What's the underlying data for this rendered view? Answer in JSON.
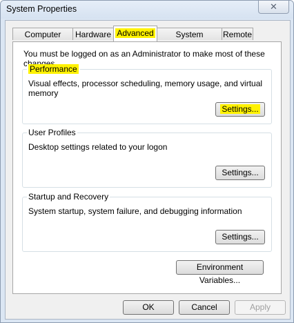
{
  "window": {
    "title": "System Properties",
    "close_glyph": "✕"
  },
  "tabs": [
    {
      "label": "Computer Name",
      "active": false
    },
    {
      "label": "Hardware",
      "active": false
    },
    {
      "label": "Advanced",
      "active": true
    },
    {
      "label": "System Protection",
      "active": false
    },
    {
      "label": "Remote",
      "active": false
    }
  ],
  "notice": "You must be logged on as an Administrator to make most of these changes.",
  "groups": {
    "performance": {
      "label": "Performance",
      "description": "Visual effects, processor scheduling, memory usage, and virtual memory",
      "button": "Settings..."
    },
    "user_profiles": {
      "label": "User Profiles",
      "description": "Desktop settings related to your logon",
      "button": "Settings..."
    },
    "startup_recovery": {
      "label": "Startup and Recovery",
      "description": "System startup, system failure, and debugging information",
      "button": "Settings..."
    }
  },
  "env_button": "Environment Variables...",
  "footer": {
    "ok": "OK",
    "cancel": "Cancel",
    "apply": "Apply"
  },
  "colors": {
    "highlight": "#fff200",
    "window_frame": "#dbe6f3"
  }
}
